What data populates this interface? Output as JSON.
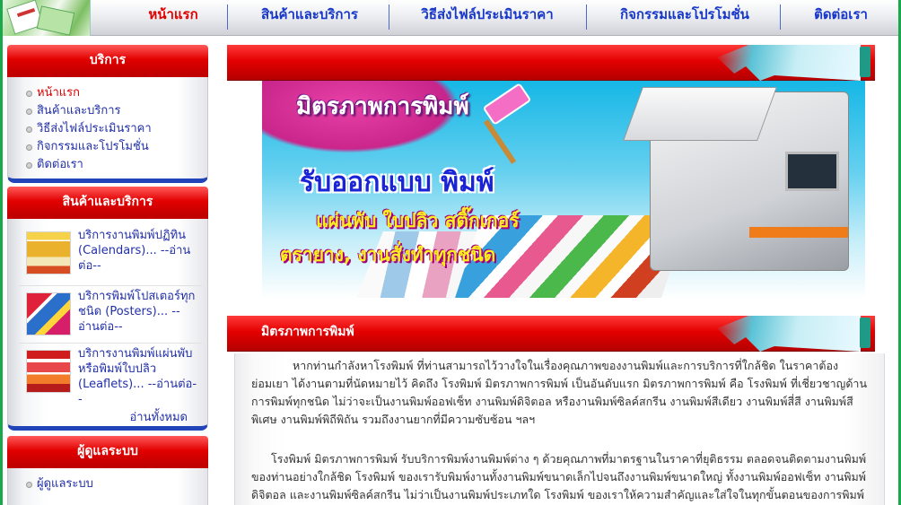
{
  "nav": {
    "items": [
      {
        "label": "หน้าแรก",
        "active": true
      },
      {
        "label": "สินค้าและบริการ"
      },
      {
        "label": "วิธีส่งไฟล์ประเมินราคา"
      },
      {
        "label": "กิจกรรมและโปรโมชั่น"
      },
      {
        "label": "ติดต่อเรา"
      }
    ]
  },
  "sidebar": {
    "services": {
      "title": "บริการ",
      "items": [
        {
          "label": "หน้าแรก",
          "active": true
        },
        {
          "label": "สินค้าและบริการ"
        },
        {
          "label": "วิธีส่งไฟล์ประเมินราคา"
        },
        {
          "label": "กิจกรรมและโปรโมชั่น"
        },
        {
          "label": "ติดต่อเรา"
        }
      ]
    },
    "products": {
      "title": "สินค้าและบริการ",
      "items": [
        {
          "text": "บริการงานพิมพ์ปฏิทิน (Calendars)... --อ่านต่อ--"
        },
        {
          "text": "บริการพิมพ์โปสเตอร์ทุกชนิด (Posters)... --อ่านต่อ--"
        },
        {
          "text": "บริการงานพิมพ์แผ่นพับหรือพิมพ์ใบปลิว (Leaflets)... --อ่านต่อ--"
        }
      ],
      "read_all": "อ่านทั้งหมด"
    },
    "admin": {
      "title": "ผู้ดูแลระบบ",
      "items": [
        {
          "label": "ผู้ดูแลระบบ"
        }
      ]
    }
  },
  "banner": {
    "line1": "มิตรภาพการพิมพ์",
    "line2": "รับออกแบบ พิมพ์",
    "line3": "แผ่นพับ ใบปลิว สติ๊กเกอร์",
    "line4": "ตรายาง, งานสั่งทำทุกชนิด"
  },
  "article": {
    "title": "มิตรภาพการพิมพ์",
    "para1": "หากท่านกำลังหาโรงพิมพ์ ที่ท่านสามารถไว้วางใจในเรื่องคุณภาพของงานพิมพ์และการบริการที่ใกล้ชิด ในราคาต้องย่อมเยา ได้งานตามที่นัดหมายไว้ คิดถึง โรงพิมพ์ มิตรภาพการพิมพ์ เป็นอันดับแรก มิตรภาพการพิมพ์ คือ โรงพิมพ์ ที่เชี่ยวชาญด้านการพิมพ์ทุกชนิด ไม่ว่าจะเป็นงานพิมพ์ออฟเซ็ท งานพิมพ์ดิจิตอล หรืองานพิมพ์ซิลค์สกรีน งานพิมพ์สีเดียว งานพิมพ์สี่สี งานพิมพ์สีพิเศษ งานพิมพ์พิถีพิถัน รวมถึงงานยากที่มีความซับซ้อน ฯลฯ",
    "para2": "โรงพิมพ์ มิตรภาพการพิมพ์ รับบริการพิมพ์งานพิมพ์ต่าง ๆ ด้วยคุณภาพที่มาตรฐานในราคาที่ยุติธรรม ตลอดจนติดตามงานพิมพ์ของท่านอย่างใกล้ชิด โรงพิมพ์ ของเรารับพิมพ์งานทั้งงานพิมพ์ขนาดเล็กไปจนถึงงานพิมพ์ขนาดใหญ่ ทั้งงานพิมพ์ออฟเซ็ท งานพิมพ์ดิจิตอล และงานพิมพ์ซิลค์สกรีน ไม่ว่าเป็นงานพิมพ์ประเภทใด โรงพิมพ์ ของเราให้ความสำคัญและใส่ใจในทุกขั้นตอนของการพิมพ์"
  },
  "colors": {
    "nav_text": "#1737c9",
    "active": "#e00000",
    "header_red": "#e20000",
    "accent_blue": "#2145b8",
    "page_border": "#19a84a"
  }
}
